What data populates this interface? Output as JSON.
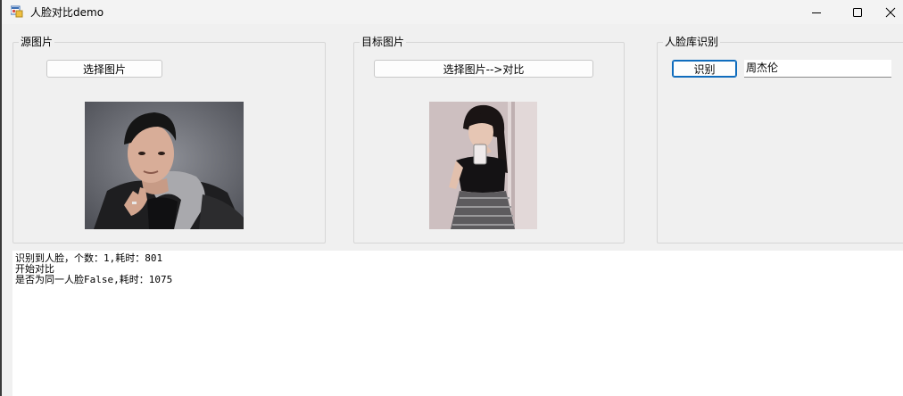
{
  "window": {
    "title": "人脸对比demo"
  },
  "source_group": {
    "label": "源图片",
    "select_button": "选择图片"
  },
  "target_group": {
    "label": "目标图片",
    "select_compare_button": "选择图片-->对比"
  },
  "facedb_group": {
    "label": "人脸库识别",
    "recognize_button": "识别",
    "name_value": "周杰伦"
  },
  "log": {
    "lines": [
      "识别到人脸，个数：1,耗时：801",
      "开始对比",
      "是否为同一人脸False,耗时：1075"
    ]
  },
  "colors": {
    "window_bg": "#f0f0f0",
    "accent": "#0f6cbd",
    "log_bg": "#ffffff"
  },
  "icons": {
    "app": "app-icon",
    "minimize": "minimize-icon",
    "maximize": "maximize-icon",
    "close": "close-icon"
  }
}
